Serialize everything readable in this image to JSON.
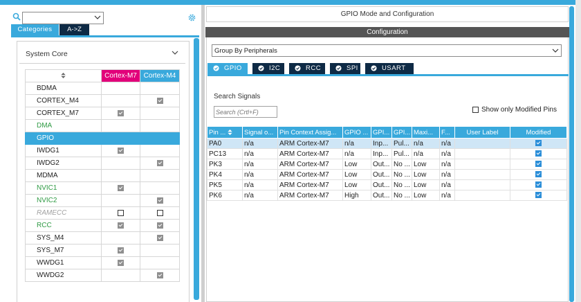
{
  "header": {
    "title": "GPIO Mode and Configuration"
  },
  "left": {
    "search_value": "",
    "tabs": [
      {
        "label": "Categories",
        "active": true
      },
      {
        "label": "A->Z",
        "active": false
      }
    ],
    "section_title": "System Core",
    "columns": [
      "Cortex-M7",
      "Cortex-M4"
    ],
    "peripherals": [
      {
        "name": "BDMA",
        "m7": "",
        "m4": "",
        "style": "normal"
      },
      {
        "name": "CORTEX_M4",
        "m7": "",
        "m4": "checked",
        "style": "normal"
      },
      {
        "name": "CORTEX_M7",
        "m7": "checked",
        "m4": "",
        "style": "normal"
      },
      {
        "name": "DMA",
        "m7": "",
        "m4": "",
        "style": "green"
      },
      {
        "name": "GPIO",
        "m7": "",
        "m4": "",
        "style": "selected"
      },
      {
        "name": "IWDG1",
        "m7": "checked",
        "m4": "",
        "style": "normal"
      },
      {
        "name": "IWDG2",
        "m7": "",
        "m4": "checked",
        "style": "normal"
      },
      {
        "name": "MDMA",
        "m7": "",
        "m4": "",
        "style": "normal"
      },
      {
        "name": "NVIC1",
        "m7": "checked",
        "m4": "",
        "style": "green"
      },
      {
        "name": "NVIC2",
        "m7": "",
        "m4": "checked",
        "style": "green"
      },
      {
        "name": "RAMECC",
        "m7": "empty",
        "m4": "empty",
        "style": "disabled"
      },
      {
        "name": "RCC",
        "m7": "checked",
        "m4": "checked",
        "style": "green-configured"
      },
      {
        "name": "SYS_M4",
        "m7": "",
        "m4": "checked",
        "style": "normal"
      },
      {
        "name": "SYS_M7",
        "m7": "checked",
        "m4": "",
        "style": "normal"
      },
      {
        "name": "WWDG1",
        "m7": "checked",
        "m4": "",
        "style": "normal"
      },
      {
        "name": "WWDG2",
        "m7": "",
        "m4": "checked",
        "style": "normal"
      }
    ]
  },
  "config": {
    "band_label": "Configuration",
    "group_by": "Group By Peripherals",
    "tabs": [
      {
        "label": "GPIO",
        "active": true
      },
      {
        "label": "I2C",
        "active": false
      },
      {
        "label": "RCC",
        "active": false
      },
      {
        "label": "SPI",
        "active": false
      },
      {
        "label": "USART",
        "active": false
      }
    ],
    "search_label": "Search Signals",
    "search_placeholder": "Search (Crtl+F)",
    "show_modified_label": "Show only Modified Pins",
    "columns": [
      "Pin ...",
      "Signal o...",
      "Pin Context Assig...",
      "GPIO ...",
      "GPI...",
      "GPI...",
      "Maxi...",
      "F...",
      "User Label",
      "Modified"
    ],
    "rows": [
      {
        "cells": [
          "PA0",
          "n/a",
          "ARM Cortex-M7",
          "n/a",
          "Inp...",
          "Pul...",
          "n/a",
          "n/a",
          ""
        ],
        "modified": true,
        "selected": true
      },
      {
        "cells": [
          "PC13",
          "n/a",
          "ARM Cortex-M7",
          "n/a",
          "Inp...",
          "Pul...",
          "n/a",
          "n/a",
          ""
        ],
        "modified": true,
        "selected": false
      },
      {
        "cells": [
          "PK3",
          "n/a",
          "ARM Cortex-M7",
          "Low",
          "Out...",
          "No ...",
          "Low",
          "n/a",
          ""
        ],
        "modified": true,
        "selected": false
      },
      {
        "cells": [
          "PK4",
          "n/a",
          "ARM Cortex-M7",
          "Low",
          "Out...",
          "No ...",
          "Low",
          "n/a",
          ""
        ],
        "modified": true,
        "selected": false
      },
      {
        "cells": [
          "PK5",
          "n/a",
          "ARM Cortex-M7",
          "Low",
          "Out...",
          "No ...",
          "Low",
          "n/a",
          ""
        ],
        "modified": true,
        "selected": false
      },
      {
        "cells": [
          "PK6",
          "n/a",
          "ARM Cortex-M7",
          "High",
          "Out...",
          "No ...",
          "Low",
          "n/a",
          ""
        ],
        "modified": true,
        "selected": false
      }
    ]
  },
  "colors": {
    "accent": "#39a9dc",
    "navy": "#0e2a45",
    "magenta": "#e2007a",
    "green": "#2e9a43"
  }
}
